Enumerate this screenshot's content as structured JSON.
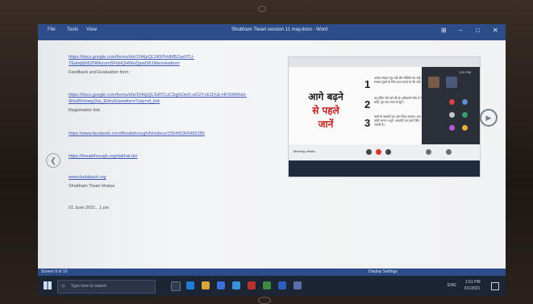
{
  "window": {
    "title": "Shubham Tiwari session 11 may.docx - Word",
    "menus": [
      "File",
      "Tools",
      "View"
    ],
    "controls": [
      "⊞",
      "–",
      "□",
      "✕"
    ]
  },
  "document": {
    "lines": [
      {
        "text": "https://docs.google.com/forms/d/e/1FAIpQLSfGPHdMBZqe9TU-",
        "kind": "link"
      },
      {
        "text": "TEahq5jh5ZNWoromSPqHQHWwQpxd361Mw/viewform",
        "kind": "link"
      },
      {
        "text": "Feedback and Evaluation form",
        "kind": "plain"
      },
      {
        "text": "https://docs.google.com/forms/d/e/1FAIpQLSdf7CuC3qjfxOwS-wG2YcE1DyE-HFtSWbNol-",
        "kind": "link"
      },
      {
        "text": "9Ihn8Vnmeg1ha_Ehhv6/viewform?usp=sf_link",
        "kind": "link"
      },
      {
        "text": "Registration link",
        "kind": "plain"
      },
      {
        "text": "https://www.facebook.com/BreakthroughIN/videos/155495306482285",
        "kind": "link"
      },
      {
        "text": "https://breakthrough.org/dakhal-do/",
        "kind": "link"
      },
      {
        "text": "www.dudaback.org",
        "kind": "link"
      },
      {
        "text": "Shubham Tiwari bhaiya",
        "kind": "plain"
      },
      {
        "text": "01 June 2021 , 1 pm",
        "kind": "plain"
      }
    ]
  },
  "video": {
    "heading_line1": "आगे बढ़ने",
    "heading_line2": "से पहले",
    "heading_line3": "जानें",
    "numbers": [
      "1",
      "2",
      "3"
    ],
    "points": [
      "अपना माइक म्यूट रखें और वीडियो बंद रखें। सवाल पूछने के लिए हाथ उठाएं या चैट करें।",
      "यह ट्रेनिंग तीन घंटे की है। प्रतिभागी बीच में न छोड़ें, पूरा सत्र ध्यान से सुनें।",
      "सभी के सवालों का उत्तर दिया जाएगा। अंत में फॉर्म भरना न भूलें, आपकी राय हमारे लिए जरूरी है।"
    ],
    "meeting_label": "Meeting details",
    "clock": "1:01 PM"
  },
  "statusbar": {
    "page": "Screen 9 of 10",
    "display": "Display Settings"
  },
  "taskbar": {
    "search_placeholder": "Type here to search",
    "time": "1:51 PM",
    "date": "6/1/2021",
    "lang": "ENG"
  },
  "colors": {
    "link": "#3b57b5",
    "accent": "#2c4d8a",
    "red_heading": "#c11e1e"
  }
}
